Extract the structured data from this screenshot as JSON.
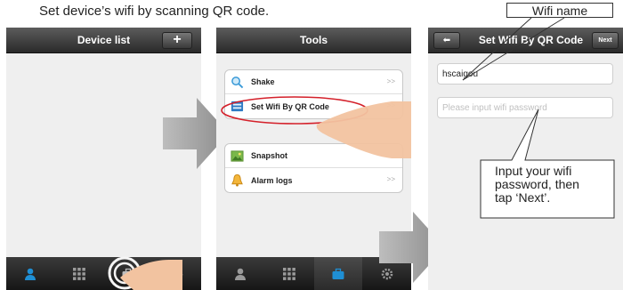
{
  "caption": "Set device’s wifi by scanning QR code.",
  "screen1": {
    "title": "Device list",
    "add_button": "+",
    "tabs": [
      "user-icon",
      "grid-icon",
      "toolbox-icon",
      "gear-icon"
    ],
    "active_tab": 2
  },
  "screen2": {
    "title": "Tools",
    "group1": [
      {
        "label": "Shake",
        "icon": "magnifier-icon",
        "chevron": ">>"
      },
      {
        "label": "Set Wifi By QR Code",
        "icon": "qr-scan-icon",
        "chevron": ">>"
      }
    ],
    "group2": [
      {
        "label": "Snapshot",
        "icon": "picture-icon",
        "chevron": ""
      },
      {
        "label": "Alarm logs",
        "icon": "bell-icon",
        "chevron": ">>"
      }
    ],
    "active_tab": 2
  },
  "screen3": {
    "title": "Set Wifi By QR Code",
    "back_button": "⬅",
    "next_button": "Next",
    "wifi_name_value": "hscaigou",
    "password_placeholder": "Please input wifi password"
  },
  "callouts": {
    "wifi_name": "Wifi name",
    "password_note_lines": [
      "Input your wifi",
      "password, then",
      "tap ‘Next’."
    ]
  },
  "colors": {
    "accent_blue": "#1f8fd4",
    "arrow_gray": "#9a9a9a",
    "highlight_red": "#d4202a"
  }
}
